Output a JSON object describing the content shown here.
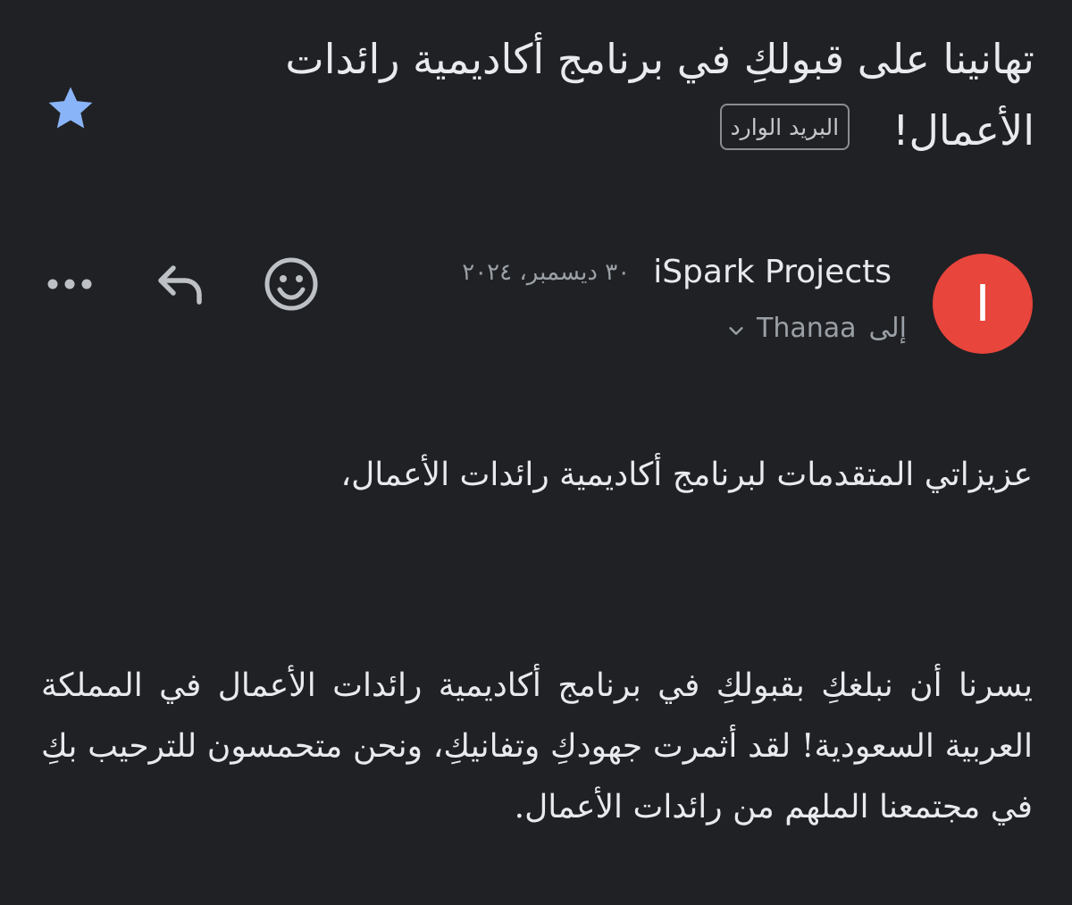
{
  "email": {
    "subject": "تهانينا على قبولكِ في برنامج أكاديمية رائدات الأعمال!",
    "label": "البريد الوارد",
    "starred": true,
    "star_color": "#8ab4f8",
    "sender": {
      "avatar_letter": "I",
      "avatar_color": "#e8453c",
      "name": "iSpark Projects",
      "date": "٣٠ ديسمبر، ٢٠٢٤",
      "to_prefix": "إلى",
      "to_name": "Thanaa"
    },
    "actions": {
      "emoji_icon": "smiley-icon",
      "reply_icon": "reply-icon",
      "more_icon": "more-horizontal-icon"
    },
    "body": {
      "greeting": "عزيزاتي المتقدمات لبرنامج أكاديمية رائدات الأعمال،",
      "paragraph": "يسرنا أن نبلغكِ بقبولكِ في برنامج أكاديمية رائدات الأعمال في المملكة العربية السعودية! لقد أثمرت جهودكِ وتفانيكِ، ونحن متحمسون للترحيب بكِ في مجتمعنا الملهم من رائدات الأعمال."
    }
  }
}
